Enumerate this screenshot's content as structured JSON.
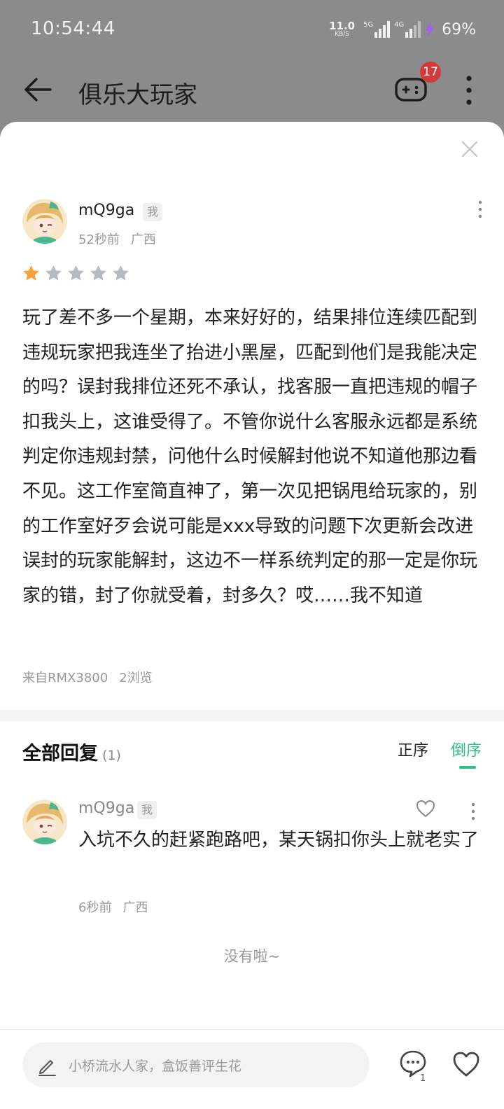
{
  "status_bar": {
    "time": "10:54:44",
    "net_speed": "11.0",
    "net_unit": "KB/S",
    "signal1_label": "5G",
    "signal2_label": "4G",
    "battery": "69%"
  },
  "app_bar": {
    "title": "俱乐大玩家",
    "badge_count": "17"
  },
  "post": {
    "username": "mQ9ga",
    "me_tag": "我",
    "time_ago": "52秒前",
    "region": "广西",
    "rating": 1,
    "rating_max": 5,
    "content": "玩了差不多一个星期，本来好好的，结果排位连续匹配到违规玩家把我连坐了抬进小黑屋，匹配到他们是我能决定的吗？误封我排位还死不承认，找客服一直把违规的帽子扣我头上，这谁受得了。不管你说什么客服永远都是系统判定你违规封禁，问他什么时候解封他说不知道他那边看不见。这工作室简直神了，第一次见把锅甩给玩家的，别的工作室好歹会说可能是xxx导致的问题下次更新会改进误封的玩家能解封，这边不一样系统判定的那一定是你玩家的错，封了你就受着，封多久？哎……我不知道",
    "device": "来自RMX3800",
    "views": "2浏览"
  },
  "replies_section": {
    "title": "全部回复",
    "count": "(1)",
    "sort_asc": "正序",
    "sort_desc": "倒序",
    "active_sort": "倒序"
  },
  "replies": [
    {
      "username": "mQ9ga",
      "me_tag": "我",
      "text": "入坑不久的赶紧跑路吧，某天锅扣你头上就老实了",
      "time_ago": "6秒前",
      "region": "广西"
    }
  ],
  "end_note": "没有啦~",
  "bottom_bar": {
    "input_placeholder": "小桥流水人家，盒饭善评生花",
    "comment_count": "1"
  },
  "colors": {
    "accent": "#2dbf83",
    "star_active": "#f7a234",
    "star_inactive": "#b4b9c4",
    "badge": "#d33a3a"
  }
}
